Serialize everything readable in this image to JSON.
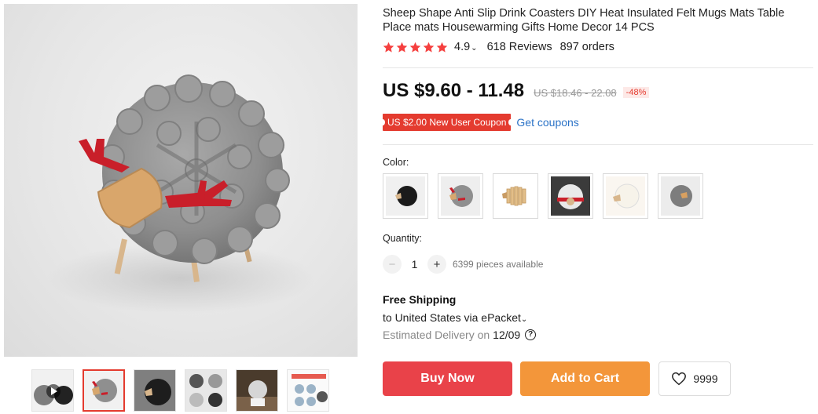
{
  "product": {
    "title": "Sheep Shape Anti Slip Drink Coasters DIY Heat Insulated Felt Mugs Mats Table Place mats Housewarming Gifts Home Decor 14 PCS",
    "rating_score": "4.9",
    "rating_value": 4.9,
    "reviews": "618 Reviews",
    "orders": "897 orders"
  },
  "pricing": {
    "price": "US $9.60 - 11.48",
    "original_price": "US $18.46 - 22.08",
    "discount": "-48%",
    "coupon_label": "US $2.00 New User Coupon",
    "get_coupons": "Get coupons"
  },
  "options": {
    "color_label": "Color:",
    "color_swatches": [
      {
        "name": "black-sheep"
      },
      {
        "name": "gray-sheep-red-antlers"
      },
      {
        "name": "wooden-sheep"
      },
      {
        "name": "white-sheep-red-antlers"
      },
      {
        "name": "white-sheep"
      },
      {
        "name": "gray-sheep"
      }
    ],
    "quantity_label": "Quantity:",
    "quantity": "1",
    "minus": "−",
    "plus": "+",
    "available": "6399 pieces available"
  },
  "shipping": {
    "title": "Free Shipping",
    "destination": "to United States via ePacket",
    "estimated_label": "Estimated Delivery on",
    "estimated_date": "12/09",
    "help": "?"
  },
  "actions": {
    "buy_now": "Buy Now",
    "add_to_cart": "Add to Cart",
    "wishlist_count": "9999"
  },
  "gallery": {
    "thumbnails": [
      {
        "name": "video-thumbnail"
      },
      {
        "name": "gray-sheep-thumbnail"
      },
      {
        "name": "black-sheep-closeup-thumbnail"
      },
      {
        "name": "coasters-set-thumbnail"
      },
      {
        "name": "lifestyle-thumbnail"
      },
      {
        "name": "infographic-thumbnail"
      }
    ],
    "active_thumbnail": 1
  },
  "colors": {
    "accent_red": "#e43b2f",
    "buy_now": "#e94249",
    "add_to_cart": "#f3963a",
    "link_blue": "#2b73c7",
    "star": "#f5403f"
  }
}
